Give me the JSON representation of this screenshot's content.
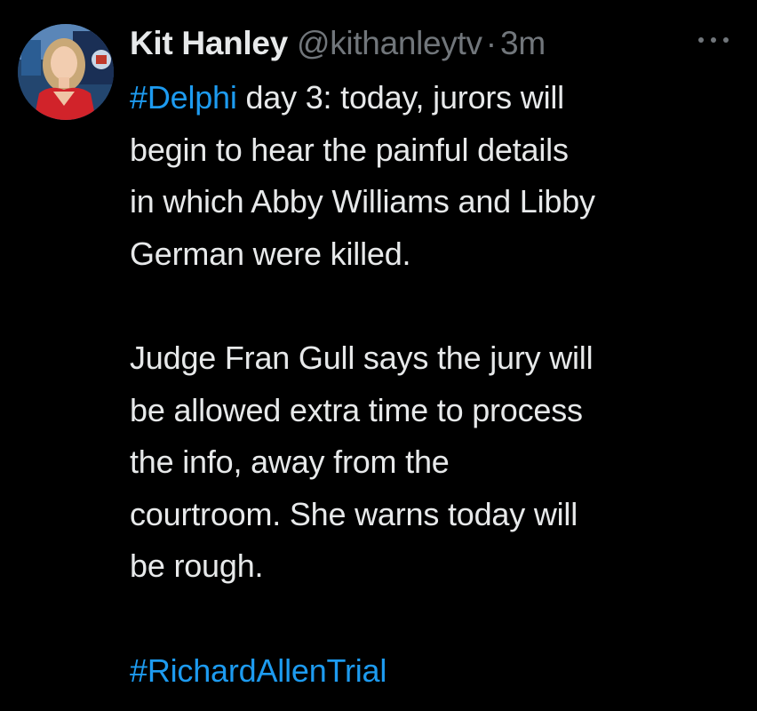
{
  "tweet": {
    "author_name": "Kit Hanley",
    "author_handle": "@kithanleytv",
    "separator": "·",
    "timestamp": "3m",
    "paragraph1": {
      "hashtag": "#Delphi",
      "line1_rest": " day 3: today, jurors will",
      "line2": "begin to hear the painful details",
      "line3": "in which Abby Williams and Libby",
      "line4": "German were killed."
    },
    "paragraph2": {
      "line1": "Judge Fran Gull says the jury will",
      "line2": "be allowed extra time to process",
      "line3": "the info, away from the",
      "line4": "courtroom. She warns today will",
      "line5": "be rough."
    },
    "footer_hashtag": "#RichardAllenTrial"
  },
  "icons": {
    "more": "more-horizontal-icon",
    "avatar": "avatar"
  },
  "colors": {
    "background": "#000000",
    "primary_text": "#e7e9ea",
    "secondary_text": "#71767b",
    "link": "#1d9bf0"
  }
}
